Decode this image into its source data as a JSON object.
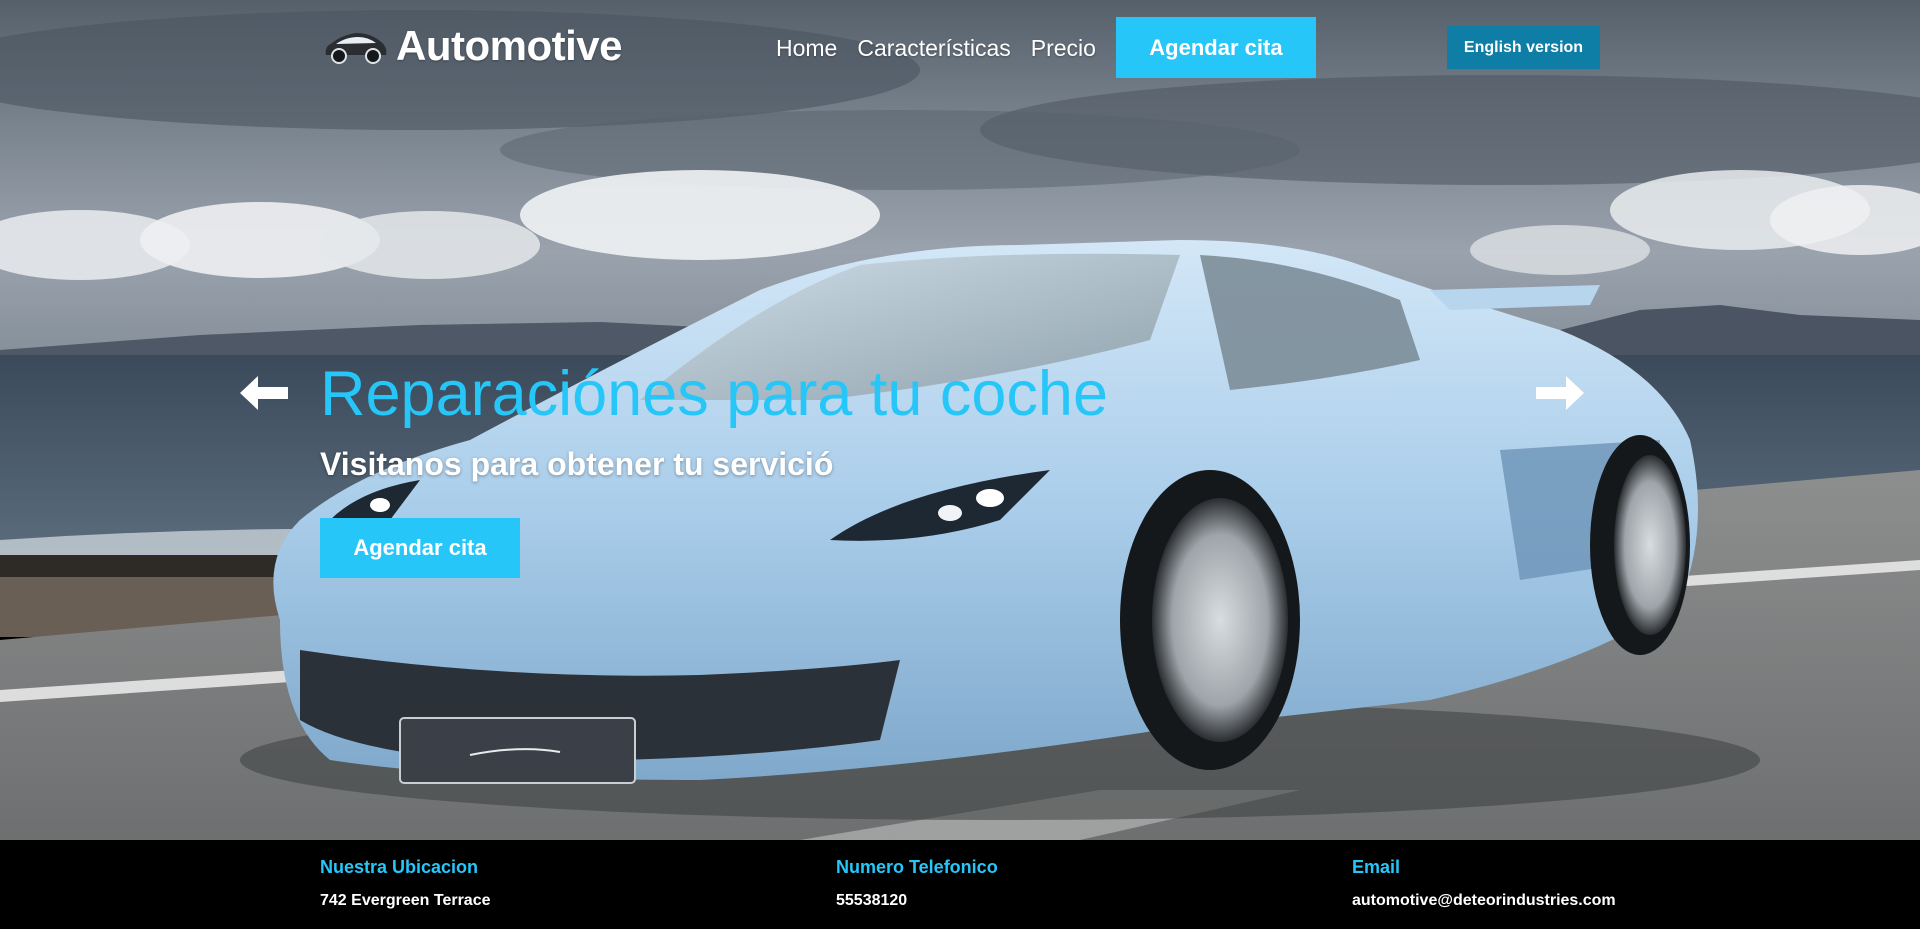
{
  "header": {
    "logo_text": "Automotive",
    "nav": [
      {
        "label": "Home"
      },
      {
        "label": "Características"
      },
      {
        "label": "Precio"
      }
    ],
    "cta_label": "Agendar cita",
    "lang_label": "English version"
  },
  "hero": {
    "title": "Reparaciónes para tu coche",
    "subtitle": "Visitanos para obtener tu servició",
    "cta_label": "Agendar cita"
  },
  "footer": {
    "columns": [
      {
        "heading": "Nuestra Ubicacion",
        "value": "742 Evergreen Terrace"
      },
      {
        "heading": "Numero Telefonico",
        "value": "55538120"
      },
      {
        "heading": "Email",
        "value": "automotive@deteorindustries.com"
      }
    ]
  },
  "colors": {
    "accent": "#26c6f9",
    "lang_button": "#0e7ea6",
    "footer_bg": "#000000",
    "car_body": "#a9cdea"
  },
  "icons": {
    "logo": "car-logo-icon",
    "prev": "arrow-left-icon",
    "next": "arrow-right-icon"
  }
}
